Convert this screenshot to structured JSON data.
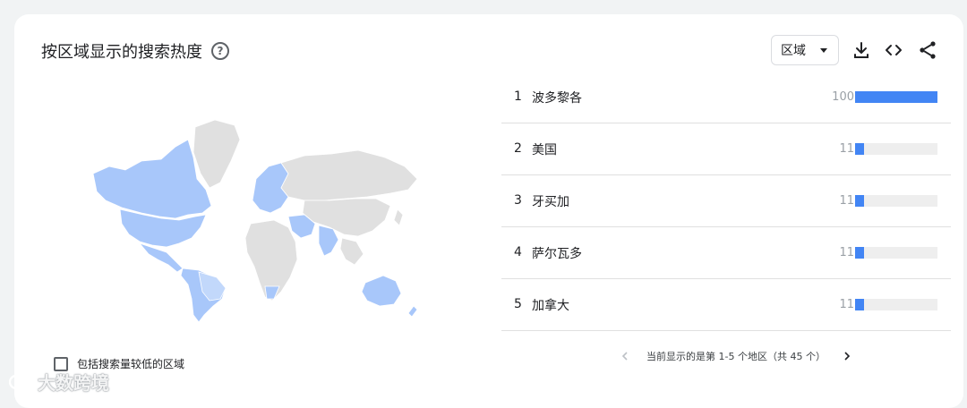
{
  "header": {
    "title": "按区域显示的搜索热度",
    "help_glyph": "?"
  },
  "toolbar": {
    "region_label": "区域",
    "download_icon": "download-icon",
    "embed_icon": "code-icon",
    "share_icon": "share-icon"
  },
  "colors": {
    "accent": "#4285f4",
    "map_active": "#a8c7fa",
    "map_inactive": "#e0e0e0"
  },
  "list": {
    "rows": [
      {
        "rank": "1",
        "name": "波多黎各",
        "value": "100",
        "pct": 100
      },
      {
        "rank": "2",
        "name": "美国",
        "value": "11",
        "pct": 11
      },
      {
        "rank": "3",
        "name": "牙买加",
        "value": "11",
        "pct": 11
      },
      {
        "rank": "4",
        "name": "萨尔瓦多",
        "value": "11",
        "pct": 11
      },
      {
        "rank": "5",
        "name": "加拿大",
        "value": "11",
        "pct": 11
      }
    ]
  },
  "pagination": {
    "text": "当前显示的是第 1-5 个地区（共 45 个）"
  },
  "footer": {
    "checkbox_label": "包括搜索量较低的区域",
    "checked": false
  },
  "watermark": {
    "text": "大数跨境"
  }
}
